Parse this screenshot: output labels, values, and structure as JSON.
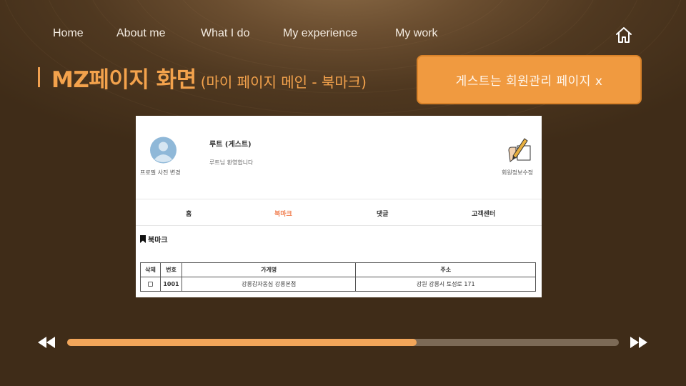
{
  "nav": {
    "items": [
      {
        "label": "Home"
      },
      {
        "label": "About me"
      },
      {
        "label": "What I do"
      },
      {
        "label": "My experience"
      },
      {
        "label": "My work"
      }
    ]
  },
  "title": {
    "main": "MZ페이지 화면",
    "sub": "(마이 페이지 메인 - 북마크)"
  },
  "guest_note": "게스트는 회원관리 페이지 x",
  "screenshot": {
    "avatar_label": "프로필 사진 변경",
    "user_name": "루트 (게스트)",
    "welcome": "루트님 환영합니다",
    "edit_label": "회원정보수정",
    "tabs": [
      {
        "label": "홈"
      },
      {
        "label": "북마크"
      },
      {
        "label": "댓글"
      },
      {
        "label": "고객센터"
      }
    ],
    "bookmark_heading": "북마크",
    "table": {
      "headers": [
        "삭제",
        "번호",
        "가게명",
        "주소"
      ],
      "rows": [
        {
          "number": "1001",
          "store": "강릉감자옹심 강릉본점",
          "address": "강원 강릉시 토성로 171"
        }
      ]
    }
  },
  "player": {
    "progress": 0.634
  },
  "colors": {
    "accent": "#f3a24c",
    "active_tab": "#f07a4a",
    "progress_fill": "#f2a65a",
    "progress_track": "#7c6a56"
  }
}
